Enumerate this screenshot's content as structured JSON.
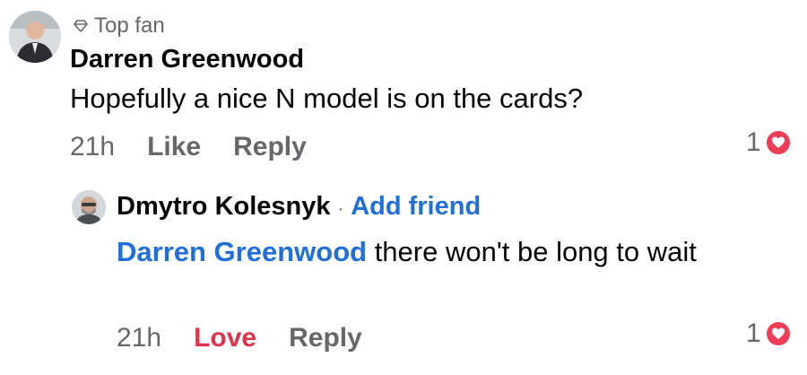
{
  "comment": {
    "badge": "Top fan",
    "author": "Darren Greenwood",
    "text": "Hopefully a nice N model is on the cards?",
    "time": "21h",
    "like_label": "Like",
    "reply_label": "Reply",
    "reaction_count": "1",
    "reaction_icon": "heart-icon"
  },
  "reply": {
    "author": "Dmytro Kolesnyk",
    "separator": "·",
    "add_friend_label": "Add friend",
    "mention": "Darren Greenwood",
    "text": "there won't be long to wait",
    "time": "21h",
    "love_label": "Love",
    "reply_label": "Reply",
    "reaction_count": "1",
    "reaction_icon": "heart-icon"
  },
  "colors": {
    "link_blue": "#216fdb",
    "love_red": "#e0344e",
    "secondary_gray": "#65676b",
    "heart_red": "#ee3d55"
  }
}
